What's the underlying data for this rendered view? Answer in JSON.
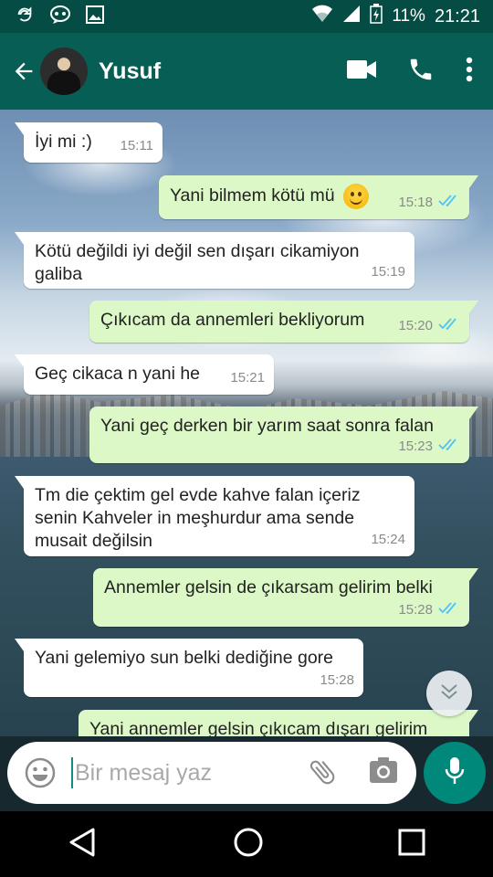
{
  "status_bar": {
    "battery": "11%",
    "time": "21:21"
  },
  "header": {
    "contact_name": "Yusuf",
    "icons": [
      "back-arrow-icon",
      "video-call-icon",
      "phone-icon",
      "more-vert-icon"
    ]
  },
  "messages": [
    {
      "dir": "in",
      "text": "İyi mi :)",
      "time": "15:11"
    },
    {
      "dir": "out",
      "text": "Yani bilmem kötü mü",
      "time": "15:18",
      "emoji": "smiley",
      "read": true
    },
    {
      "dir": "in",
      "text": "Kötü değildi iyi değil sen dışarı cikamiyon galiba",
      "time": "15:19"
    },
    {
      "dir": "out",
      "text": "Çıkıcam da annemleri bekliyorum",
      "time": "15:20",
      "read": true
    },
    {
      "dir": "in",
      "text": "Geç cikaca n yani he",
      "time": "15:21"
    },
    {
      "dir": "out",
      "text": "Yani geç derken bir yarım saat sonra falan",
      "time": "15:23",
      "read": true
    },
    {
      "dir": "in",
      "text": "Tm die çektim gel evde kahve falan içeriz senin Kahveler in meşhurdur ama sende musait değilsin",
      "time": "15:24"
    },
    {
      "dir": "out",
      "text": "Annemler gelsin de çıkarsam gelirim belki",
      "time": "15:28",
      "read": true
    },
    {
      "dir": "in",
      "text": "Yani gelemiyo sun belki dediğine gore",
      "time": "15:28"
    },
    {
      "dir": "out",
      "text": "Yani annemler gelsin çıkıcam dışarı gelirim",
      "time": ""
    }
  ],
  "input": {
    "placeholder": "Bir mesaj yaz"
  },
  "colors": {
    "header": "#075e54",
    "status_bar": "#054d44",
    "outgoing_bubble": "#dcf8c6",
    "incoming_bubble": "#ffffff",
    "mic_button": "#00897b",
    "read_ticks": "#4fc3f7"
  }
}
